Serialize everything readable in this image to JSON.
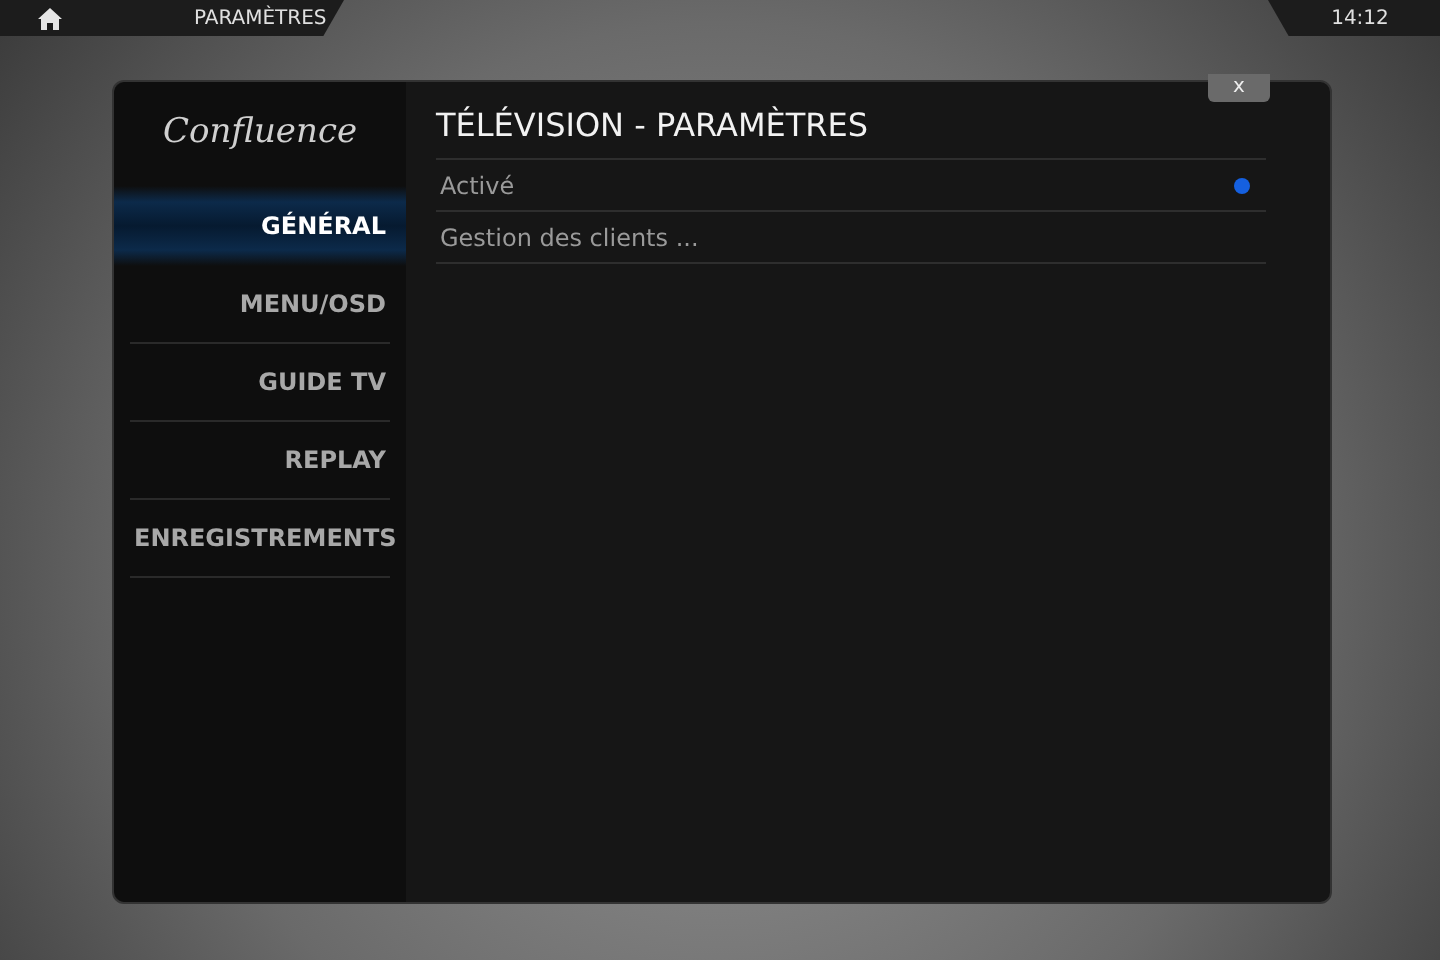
{
  "top_bar": {
    "breadcrumb": "PARAMÈTRES",
    "clock": "14:12"
  },
  "dialog": {
    "logo": "Confluence",
    "title": "TÉLÉVISION - PARAMÈTRES",
    "close": "x"
  },
  "sidebar": {
    "items": [
      {
        "label": "GÉNÉRAL",
        "selected": true
      },
      {
        "label": "MENU/OSD",
        "selected": false
      },
      {
        "label": "GUIDE TV",
        "selected": false
      },
      {
        "label": "REPLAY",
        "selected": false
      },
      {
        "label": "ENREGISTREMENTS",
        "selected": false
      }
    ]
  },
  "settings": [
    {
      "kind": "toggle",
      "label": "Activé",
      "on": true
    },
    {
      "kind": "action",
      "label": "Gestion des clients ..."
    }
  ]
}
